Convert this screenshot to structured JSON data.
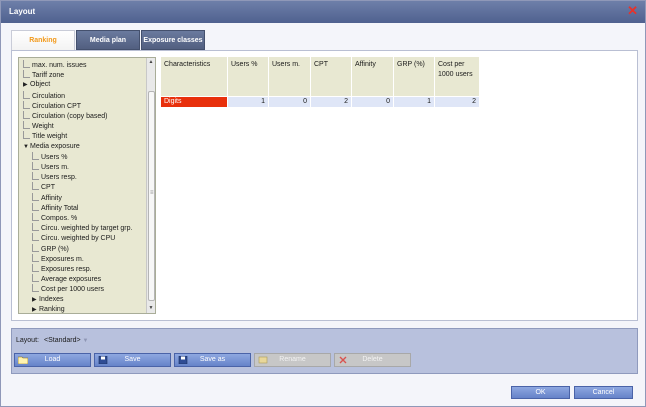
{
  "window": {
    "title": "Layout"
  },
  "tabs": [
    {
      "label": "Ranking",
      "active": true
    },
    {
      "label": "Media plan",
      "active": false
    },
    {
      "label": "Exposure classes",
      "active": false
    }
  ],
  "tree": {
    "items": [
      {
        "label": "max. num. issues",
        "level": 0,
        "kind": "leaf"
      },
      {
        "label": "Tariff zone",
        "level": 0,
        "kind": "leaf"
      },
      {
        "label": "Object",
        "level": 0,
        "kind": "collapsed"
      },
      {
        "label": "Circulation",
        "level": 0,
        "kind": "leaf"
      },
      {
        "label": "Circulation CPT",
        "level": 0,
        "kind": "leaf"
      },
      {
        "label": "Circulation (copy based)",
        "level": 0,
        "kind": "leaf"
      },
      {
        "label": "Weight",
        "level": 0,
        "kind": "leaf"
      },
      {
        "label": "Title weight",
        "level": 0,
        "kind": "leaf"
      },
      {
        "label": "Media exposure",
        "level": 0,
        "kind": "expanded"
      },
      {
        "label": "Users %",
        "level": 1,
        "kind": "leaf"
      },
      {
        "label": "Users m.",
        "level": 1,
        "kind": "leaf"
      },
      {
        "label": "Users resp.",
        "level": 1,
        "kind": "leaf"
      },
      {
        "label": "CPT",
        "level": 1,
        "kind": "leaf"
      },
      {
        "label": "Affinity",
        "level": 1,
        "kind": "leaf"
      },
      {
        "label": "Affinity Total",
        "level": 1,
        "kind": "leaf"
      },
      {
        "label": "Compos. %",
        "level": 1,
        "kind": "leaf"
      },
      {
        "label": "Circu. weighted by target grp.",
        "level": 1,
        "kind": "leaf"
      },
      {
        "label": "Circu. weighted by CPU",
        "level": 1,
        "kind": "leaf"
      },
      {
        "label": "GRP (%)",
        "level": 1,
        "kind": "leaf"
      },
      {
        "label": "Exposures m.",
        "level": 1,
        "kind": "leaf"
      },
      {
        "label": "Exposures resp.",
        "level": 1,
        "kind": "leaf"
      },
      {
        "label": "Average exposures",
        "level": 1,
        "kind": "leaf"
      },
      {
        "label": "Cost per 1000 users",
        "level": 1,
        "kind": "leaf"
      },
      {
        "label": "Indexes",
        "level": 1,
        "kind": "collapsed"
      },
      {
        "label": "Ranking",
        "level": 1,
        "kind": "collapsed"
      }
    ]
  },
  "table": {
    "headers": [
      "Characteristics",
      "Users %",
      "Users m.",
      "CPT",
      "Affinity",
      "GRP (%)",
      "Cost per 1000 users"
    ],
    "rows": [
      {
        "label": "Digits",
        "values": [
          "1",
          "0",
          "2",
          "0",
          "1",
          "2"
        ]
      }
    ]
  },
  "layout_bar": {
    "label": "Layout:",
    "value": "<Standard>",
    "buttons": [
      {
        "label": "Load",
        "enabled": true,
        "icon": "folder-open-icon"
      },
      {
        "label": "Save",
        "enabled": true,
        "icon": "save-icon"
      },
      {
        "label": "Save as",
        "enabled": true,
        "icon": "save-as-icon"
      },
      {
        "label": "Rename",
        "enabled": false,
        "icon": "rename-icon"
      },
      {
        "label": "Delete",
        "enabled": false,
        "icon": "delete-icon"
      }
    ]
  },
  "footer": {
    "ok_label": "OK",
    "cancel_label": "Cancel"
  },
  "colors": {
    "titlebar": "#5d6e9a",
    "accent_tab": "#f29a1c",
    "highlight_row": "#e8300c",
    "button": "#7893d4"
  }
}
